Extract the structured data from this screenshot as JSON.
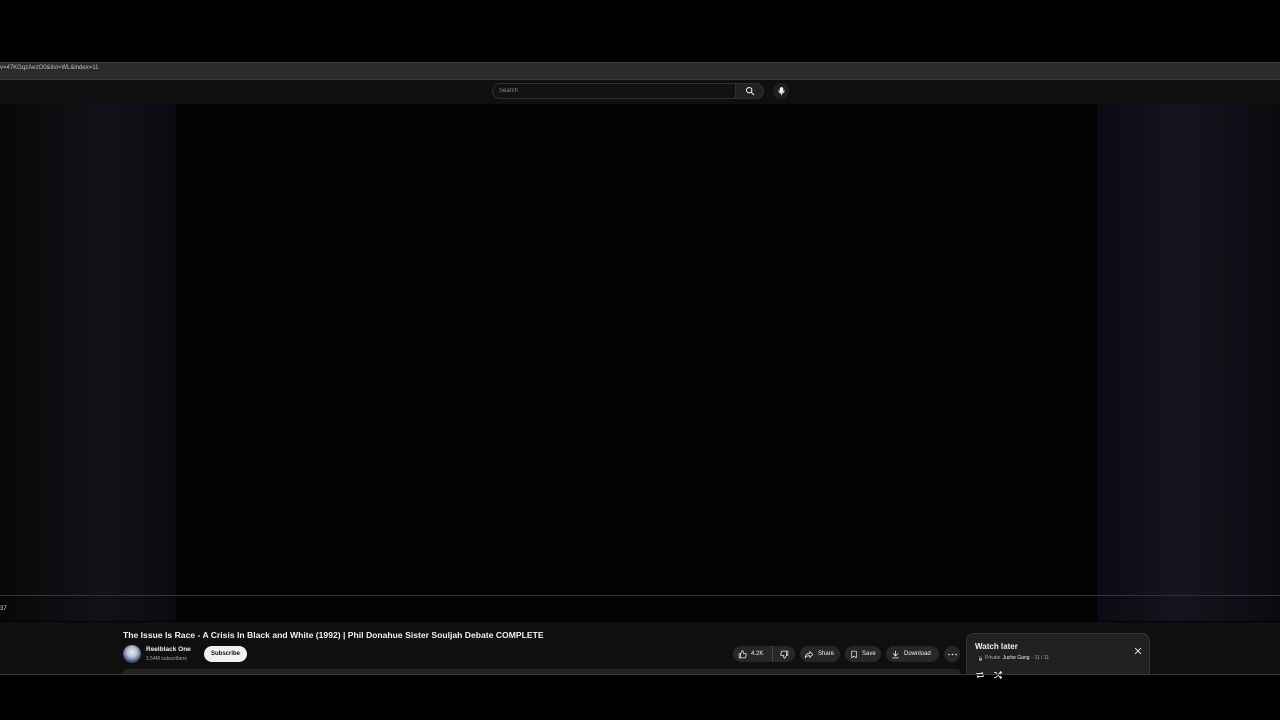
{
  "browser": {
    "url_fragment": "v=47KGqzAezO0&list=WL&index=11"
  },
  "masthead": {
    "search_placeholder": "Search",
    "search_icon": "search-icon",
    "mic_icon": "microphone-icon"
  },
  "player": {
    "time_text": "37"
  },
  "video": {
    "title": "The Issue Is Race - A Crisis In Black and White (1992) | Phil Donahue Sister Souljah Debate COMPLETE",
    "channel_name": "Reelblack One",
    "subscribers": "1.54M subscribers",
    "subscribe_label": "Subscribe",
    "like_count": "4.2K",
    "share_label": "Share",
    "save_label": "Save",
    "download_label": "Download"
  },
  "playlist": {
    "title": "Watch later",
    "privacy": "Private",
    "owner": "Juche Gang",
    "position": "- 11 / 11"
  },
  "colors": {
    "background": "#0f0f0f",
    "button_bg": "#272727",
    "subscribe_bg": "#f1f1f1"
  }
}
